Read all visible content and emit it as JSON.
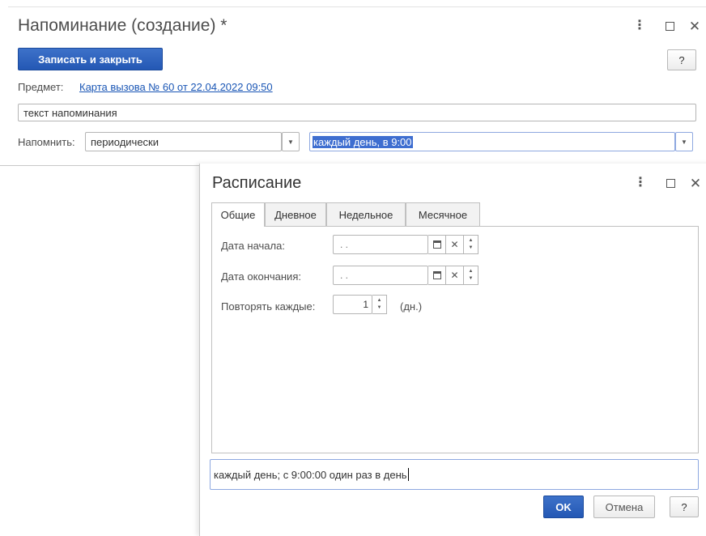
{
  "main_window": {
    "title": "Напоминание (создание) *",
    "save_close_label": "Записать и закрыть",
    "help_label": "?",
    "subject_label": "Предмет:",
    "subject_link": "Карта вызова № 60 от 22.04.2022 09:50",
    "reminder_text": "текст напоминания",
    "remind_label": "Напомнить:",
    "remind_mode": "периодически",
    "schedule_value": "каждый день, в 9:00"
  },
  "schedule_dialog": {
    "title": "Расписание",
    "tabs": [
      {
        "label": "Общие",
        "active": true
      },
      {
        "label": "Дневное",
        "active": false
      },
      {
        "label": "Недельное",
        "active": false
      },
      {
        "label": "Месячное",
        "active": false
      }
    ],
    "start_date_label": "Дата начала:",
    "start_date_value": ". .",
    "end_date_label": "Дата окончания:",
    "end_date_value": ". .",
    "repeat_label": "Повторять каждые:",
    "repeat_value": "1",
    "repeat_unit": "(дн.)",
    "summary": "каждый день; с 9:00:00 один раз в день",
    "ok_label": "OK",
    "cancel_label": "Отмена",
    "help_label": "?"
  },
  "icons": {
    "more": "more-vertical-icon",
    "maximize": "maximize-icon",
    "close": "close-icon",
    "dropdown": "chevron-down-icon",
    "calendar": "calendar-icon",
    "clear": "clear-icon",
    "spinner": "spinner-icon"
  },
  "colors": {
    "primary_button": "#2458b4",
    "link": "#1a56b5",
    "selection": "#3e6ed0",
    "focus_border": "#8ea8e0"
  }
}
